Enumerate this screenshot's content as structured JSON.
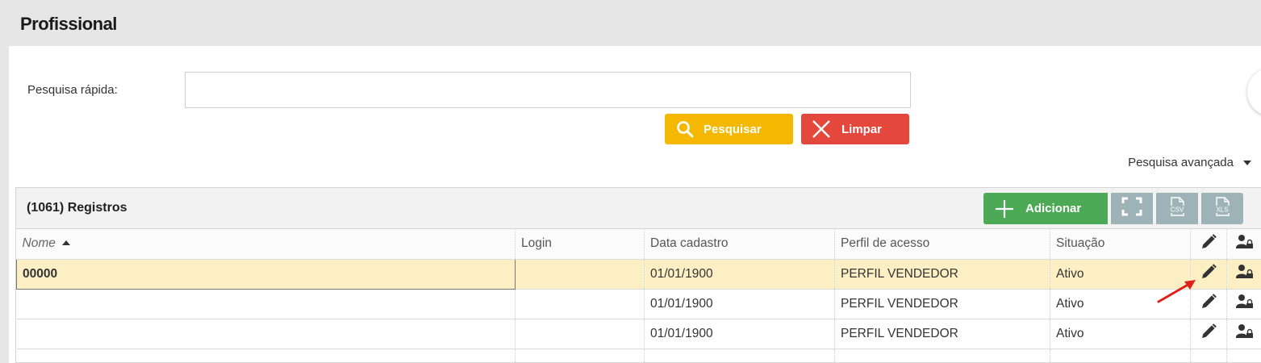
{
  "page": {
    "title": "Profissional"
  },
  "search": {
    "label": "Pesquisa rápida:",
    "value": "",
    "placeholder": "",
    "search_button": "Pesquisar",
    "clear_button": "Limpar",
    "advanced_label": "Pesquisa avançada"
  },
  "grid": {
    "records_label": "(1061) Registros",
    "add_button": "Adicionar",
    "csv_label": "CSV",
    "xls_label": "XLS",
    "columns": {
      "name": "Nome",
      "login": "Login",
      "date": "Data cadastro",
      "profile": "Perfil de acesso",
      "status": "Situação"
    },
    "rows": [
      {
        "name": "00000",
        "login": "",
        "date": "01/01/1900",
        "profile": "PERFIL VENDEDOR",
        "status": "Ativo"
      },
      {
        "name": "",
        "login": "",
        "date": "01/01/1900",
        "profile": "PERFIL VENDEDOR",
        "status": "Ativo"
      },
      {
        "name": "",
        "login": "",
        "date": "01/01/1900",
        "profile": "PERFIL VENDEDOR",
        "status": "Ativo"
      }
    ]
  },
  "colors": {
    "search_button": "#f5b800",
    "clear_button": "#e4473c",
    "add_button": "#4caa57",
    "tool_button": "#9eb3b8",
    "selected_row": "#fdefc4",
    "annotation_arrow": "#e0201a"
  },
  "icons": {
    "search": "magnifier-icon",
    "clear": "x-icon",
    "add": "plus-icon",
    "fullscreen": "fullscreen-icon",
    "csv": "csv-file-icon",
    "xls": "xls-file-icon",
    "edit": "pencil-icon",
    "permissions": "user-lock-icon"
  }
}
